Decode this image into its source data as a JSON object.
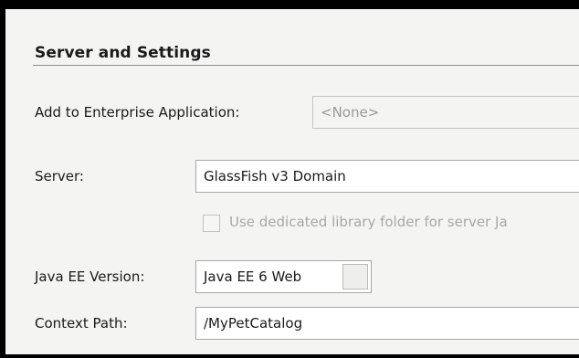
{
  "section": {
    "title": "Server and Settings"
  },
  "enterprise_app": {
    "label": "Add to Enterprise Application:",
    "value": "<None>"
  },
  "server": {
    "label": "Server:",
    "value": "GlassFish v3 Domain"
  },
  "dedicated_library": {
    "label": "Use dedicated library folder for server Ja",
    "checked": false,
    "enabled": false
  },
  "java_ee": {
    "label": "Java EE Version:",
    "value": "Java EE 6 Web"
  },
  "context_path": {
    "label": "Context Path:",
    "value": "/MyPetCatalog"
  },
  "colors": {
    "panel_bg": "#f4f4f2",
    "frame": "#000000",
    "field_border": "#a7a7a7",
    "disabled_text": "#a8a8a8"
  }
}
